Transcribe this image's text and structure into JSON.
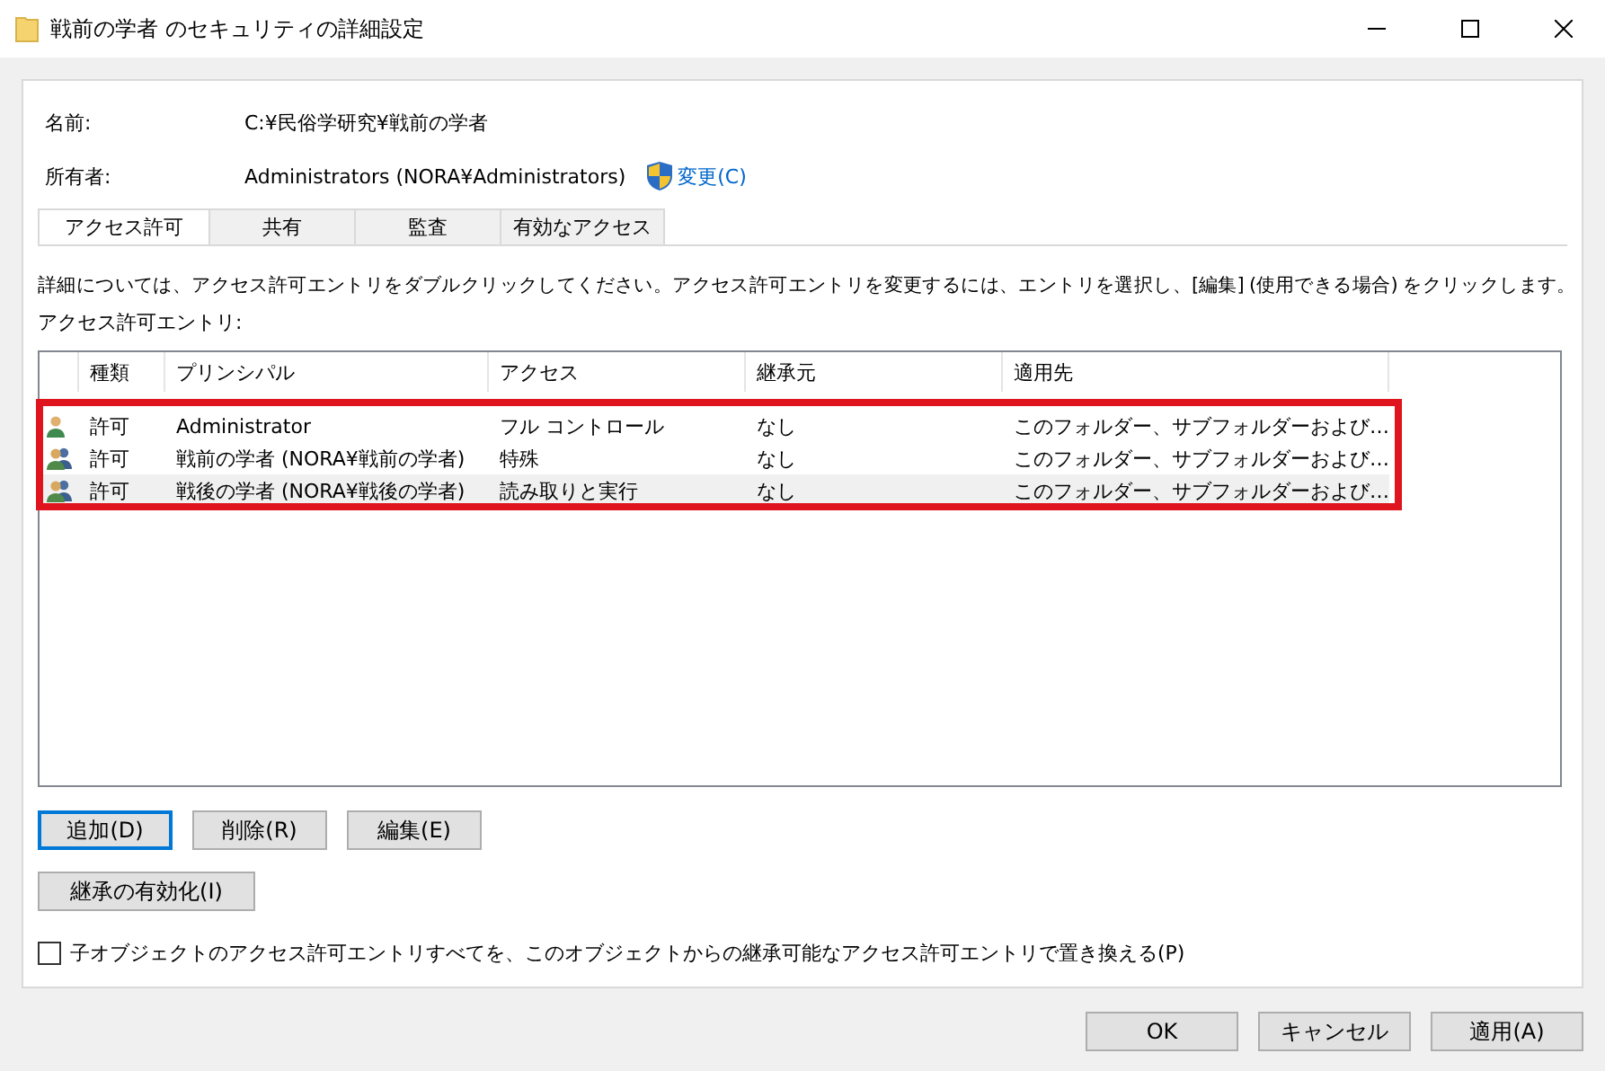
{
  "window": {
    "title": "戦前の学者 のセキュリティの詳細設定"
  },
  "name_field": {
    "label": "名前:",
    "value": "C:¥民俗学研究¥戦前の学者"
  },
  "owner_field": {
    "label": "所有者:",
    "value": "Administrators (NORA¥Administrators)",
    "change_link": "変更(C)"
  },
  "tabs": [
    {
      "label": "アクセス許可",
      "selected": true
    },
    {
      "label": "共有",
      "selected": false
    },
    {
      "label": "監査",
      "selected": false
    },
    {
      "label": "有効なアクセス",
      "selected": false
    }
  ],
  "instructions": "詳細については、アクセス許可エントリをダブルクリックしてください。アクセス許可エントリを変更するには、エントリを選択し、[編集] (使用できる場合) をクリックします。",
  "entries_label": "アクセス許可エントリ:",
  "table": {
    "columns": [
      "種類",
      "プリンシパル",
      "アクセス",
      "継承元",
      "適用先"
    ],
    "rows": [
      {
        "kind": "user",
        "hover": false,
        "cells": [
          "許可",
          "Administrator",
          "フル コントロール",
          "なし",
          "このフォルダー、サブフォルダーおよび…"
        ]
      },
      {
        "kind": "group",
        "hover": false,
        "cells": [
          "許可",
          "戦前の学者 (NORA¥戦前の学者)",
          "特殊",
          "なし",
          "このフォルダー、サブフォルダーおよび…"
        ]
      },
      {
        "kind": "group",
        "hover": true,
        "cells": [
          "許可",
          "戦後の学者 (NORA¥戦後の学者)",
          "読み取りと実行",
          "なし",
          "このフォルダー、サブフォルダーおよび…"
        ]
      }
    ]
  },
  "entry_buttons": [
    {
      "label": "追加(D)",
      "focused": true
    },
    {
      "label": "削除(R)",
      "focused": false
    },
    {
      "label": "編集(E)",
      "focused": false
    }
  ],
  "inherit_button": "継承の有効化(I)",
  "replace_checkbox": {
    "label": "子オブジェクトのアクセス許可エントリすべてを、このオブジェクトからの継承可能なアクセス許可エントリで置き換える(P)",
    "checked": false
  },
  "dialog_buttons": [
    "OK",
    "キャンセル",
    "適用(A)"
  ]
}
